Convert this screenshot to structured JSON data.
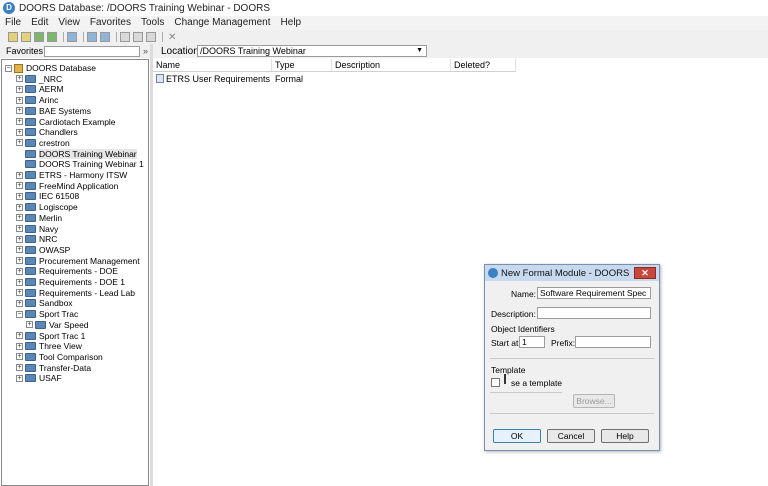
{
  "window": {
    "title": "DOORS Database: /DOORS Training Webinar - DOORS"
  },
  "menu": [
    "File",
    "Edit",
    "View",
    "Favorites",
    "Tools",
    "Change Management",
    "Help"
  ],
  "favorites": {
    "label": "Favorites",
    "chevron": "»"
  },
  "location": {
    "label": "Location",
    "value": "/DOORS Training Webinar"
  },
  "tree": {
    "root": "DOORS Database",
    "items": [
      {
        "label": "_NRC",
        "level": 1,
        "expand": "+"
      },
      {
        "label": "AERM",
        "level": 1,
        "expand": "+"
      },
      {
        "label": "Arinc",
        "level": 1,
        "expand": "+"
      },
      {
        "label": "BAE Systems",
        "level": 1,
        "expand": "+"
      },
      {
        "label": "Cardiotach Example",
        "level": 1,
        "expand": "+"
      },
      {
        "label": "Chandlers",
        "level": 1,
        "expand": "+"
      },
      {
        "label": "crestron",
        "level": 1,
        "expand": "+"
      },
      {
        "label": "DOORS Training Webinar",
        "level": 1,
        "expand": "",
        "selected": true
      },
      {
        "label": "DOORS Training Webinar 1",
        "level": 1,
        "expand": ""
      },
      {
        "label": "ETRS - Harmony ITSW",
        "level": 1,
        "expand": "+"
      },
      {
        "label": "FreeMind Application",
        "level": 1,
        "expand": "+"
      },
      {
        "label": "IEC 61508",
        "level": 1,
        "expand": "+"
      },
      {
        "label": "Logiscope",
        "level": 1,
        "expand": "+"
      },
      {
        "label": "Merlin",
        "level": 1,
        "expand": "+"
      },
      {
        "label": "Navy",
        "level": 1,
        "expand": "+"
      },
      {
        "label": "NRC",
        "level": 1,
        "expand": "+"
      },
      {
        "label": "OWASP",
        "level": 1,
        "expand": "+"
      },
      {
        "label": "Procurement Management",
        "level": 1,
        "expand": "+"
      },
      {
        "label": "Requirements - DOE",
        "level": 1,
        "expand": "+"
      },
      {
        "label": "Requirements - DOE 1",
        "level": 1,
        "expand": "+"
      },
      {
        "label": "Requirements - Lead Lab",
        "level": 1,
        "expand": "+"
      },
      {
        "label": "Sandbox",
        "level": 1,
        "expand": "+"
      },
      {
        "label": "Sport Trac",
        "level": 1,
        "expand": "−"
      },
      {
        "label": "Var Speed",
        "level": 2,
        "expand": "+"
      },
      {
        "label": "Sport Trac 1",
        "level": 1,
        "expand": "+"
      },
      {
        "label": "Three View",
        "level": 1,
        "expand": "+"
      },
      {
        "label": "Tool Comparison",
        "level": 1,
        "expand": "+"
      },
      {
        "label": "Transfer-Data",
        "level": 1,
        "expand": "+"
      },
      {
        "label": "USAF",
        "level": 1,
        "expand": "+"
      }
    ]
  },
  "list": {
    "columns": [
      "Name",
      "Type",
      "Description",
      "Deleted?"
    ],
    "rows": [
      {
        "name": "ETRS User Requirements",
        "type": "Formal",
        "description": "",
        "deleted": ""
      }
    ]
  },
  "dialog": {
    "title": "New Formal Module - DOORS",
    "close": "✕",
    "name_label": "Name:",
    "name_value": "Software Requirement Spec",
    "description_label": "Description:",
    "description_value": "",
    "object_identifiers_label": "Object Identifiers",
    "start_at_label": "Start at:",
    "start_at_value": "1",
    "prefix_label": "Prefix:",
    "prefix_value": "",
    "template_label": "Template",
    "use_template_label": "se a template",
    "browse_label": "Browse...",
    "ok_label": "OK",
    "cancel_label": "Cancel",
    "help_label": "Help"
  },
  "colors": {
    "accent": "#3b7fc4",
    "close": "#c9463d",
    "dialog_title": "#c7d9ee"
  }
}
